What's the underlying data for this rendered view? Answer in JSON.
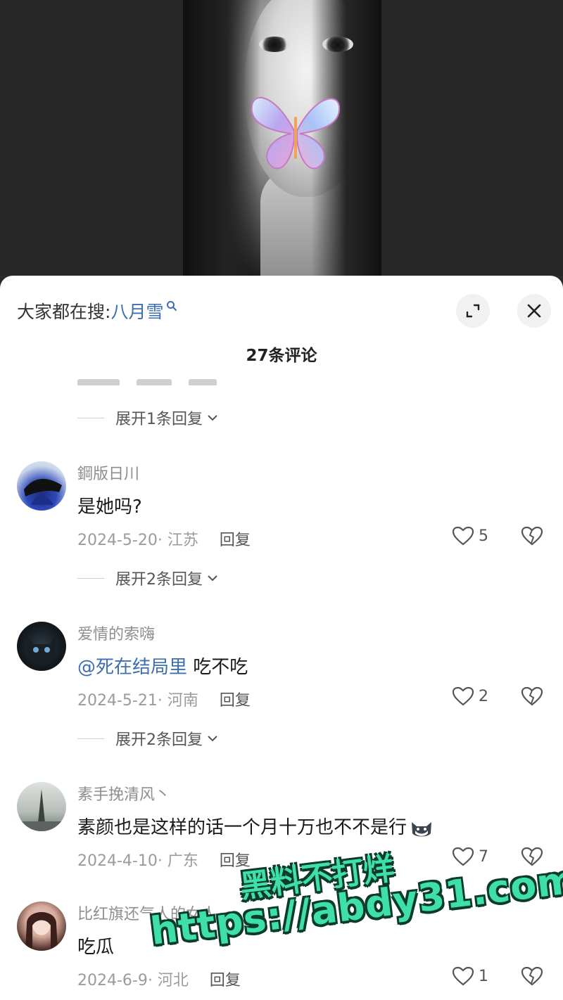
{
  "header": {
    "search_prefix": "大家都在搜:",
    "search_term": "八月雪",
    "title": "27条评论"
  },
  "icons": {
    "expand": "expand-icon",
    "close": "close-icon",
    "search": "search-icon",
    "like": "heart-icon",
    "dislike": "broken-heart-icon",
    "chevron": "chevron-down-icon"
  },
  "colors": {
    "link": "#3b6fb0",
    "watermark": "#3fe0a8"
  },
  "expand_rows": [
    {
      "label": "展开1条回复"
    },
    {
      "label": "展开2条回复"
    },
    {
      "label": "展开2条回复"
    }
  ],
  "comments": [
    {
      "username": "鋼版日川",
      "mention": "",
      "text": "是她吗?",
      "date_location": "2024-5-20· 江苏",
      "reply_label": "回复",
      "likes": "5"
    },
    {
      "username": "爱情的索嗨",
      "mention": "@死在结局里",
      "text": " 吃不吃",
      "date_location": "2024-5-21· 河南",
      "reply_label": "回复",
      "likes": "2"
    },
    {
      "username": "素手挽清风丶",
      "mention": "",
      "text": "素颜也是这样的话一个月十万也不不是行",
      "date_location": "2024-4-10· 广东",
      "reply_label": "回复",
      "likes": "7"
    },
    {
      "username": "比红旗还气人的女人",
      "mention": "",
      "text": "吃瓜",
      "date_location": "2024-6-9· 河北",
      "reply_label": "回复",
      "likes": "1"
    }
  ],
  "watermark": {
    "line1": "黑料不打烊",
    "line2": "https://abdy31.com"
  }
}
